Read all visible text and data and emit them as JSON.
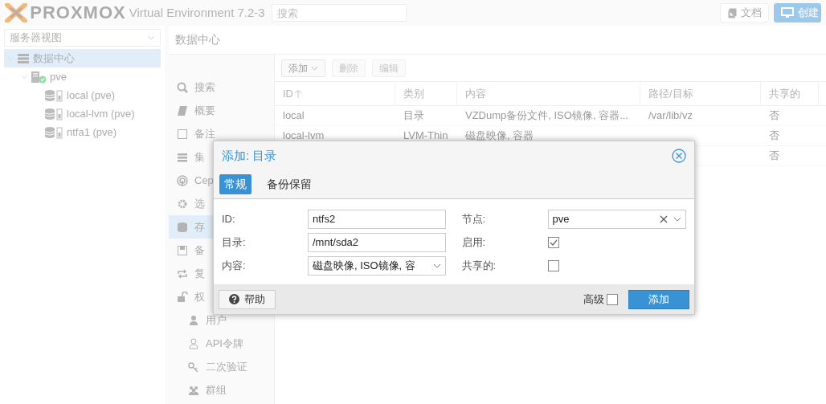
{
  "header": {
    "logo": "PROXMOX",
    "product": "Virtual Environment 7.2-3",
    "search": {
      "placeholder": "搜索"
    },
    "buttons": [
      {
        "label": "文档",
        "kind": "docs"
      },
      {
        "label": "创建",
        "kind": "create"
      }
    ]
  },
  "resource_tree": {
    "view_selector": "服务器视图",
    "items": [
      {
        "label": "数据中心",
        "kind": "datacenter",
        "selected": true,
        "expanded": true,
        "children": [
          {
            "label": "pve",
            "kind": "node",
            "selected": false,
            "expanded": true,
            "children": [
              {
                "label": "local (pve)",
                "kind": "storage",
                "selected": false
              },
              {
                "label": "local-lvm (pve)",
                "kind": "storage",
                "selected": false
              },
              {
                "label": "ntfa1 (pve)",
                "kind": "storage",
                "selected": false
              }
            ]
          }
        ]
      }
    ]
  },
  "content": {
    "title": "数据中心",
    "nav": [
      {
        "label": "搜索",
        "selected": false
      },
      {
        "label": "概要",
        "selected": false
      },
      {
        "label": "备注",
        "selected": false
      },
      {
        "label": "集",
        "selected": false
      },
      {
        "label": "Cep",
        "selected": false
      },
      {
        "label": "选",
        "selected": false
      },
      {
        "label": "存",
        "selected": true
      },
      {
        "label": "备",
        "selected": false
      },
      {
        "label": "复",
        "selected": false
      },
      {
        "label": "权",
        "selected": false,
        "children": [
          {
            "label": "用户",
            "selected": false
          },
          {
            "label": "API令牌",
            "selected": false
          },
          {
            "label": "二次验证",
            "selected": false
          },
          {
            "label": "群组",
            "selected": false
          }
        ]
      }
    ],
    "toolbar": [
      {
        "label": "添加",
        "kind": "menu",
        "disabled": false
      },
      {
        "label": "删除",
        "kind": "button",
        "disabled": true
      },
      {
        "label": "编辑",
        "kind": "button",
        "disabled": true
      }
    ],
    "grid": {
      "columns": [
        {
          "label": "ID",
          "sorted_ascending": true
        },
        {
          "label": "类别",
          "sorted_ascending": false
        },
        {
          "label": "内容",
          "sorted_ascending": false
        },
        {
          "label": "路径/目标",
          "sorted_ascending": false
        },
        {
          "label": "共享的",
          "sorted_ascending": false
        }
      ],
      "rows": [
        {
          "id": "local",
          "type": "目录",
          "content": "VZDump备份文件, ISO镜像, 容器...",
          "path": "/var/lib/vz",
          "shared": "否"
        },
        {
          "id": "local-lvm",
          "type": "LVM-Thin",
          "content": "磁盘映像, 容器",
          "shared": "否"
        },
        {
          "shared": "否"
        }
      ]
    }
  },
  "dialog": {
    "title": "添加: 目录",
    "tabs": [
      {
        "label": "常规",
        "selected": true
      },
      {
        "label": "备份保留",
        "selected": false
      }
    ],
    "left_fields": [
      {
        "label": "ID:",
        "kind": "text",
        "value": "ntfs2"
      },
      {
        "label": "目录:",
        "kind": "text",
        "value": "/mnt/sda2"
      },
      {
        "label": "内容:",
        "kind": "select",
        "value": "磁盘映像, ISO镜像, 容"
      }
    ],
    "right_fields": [
      {
        "label": "节点:",
        "kind": "combo",
        "value": "pve"
      },
      {
        "label": "启用:",
        "kind": "checkbox",
        "checked": true
      },
      {
        "label": "共享的:",
        "kind": "checkbox",
        "checked": false
      }
    ],
    "help_button": "帮助",
    "advanced": {
      "label": "高级",
      "checked": false
    },
    "submit_button": "添加"
  }
}
